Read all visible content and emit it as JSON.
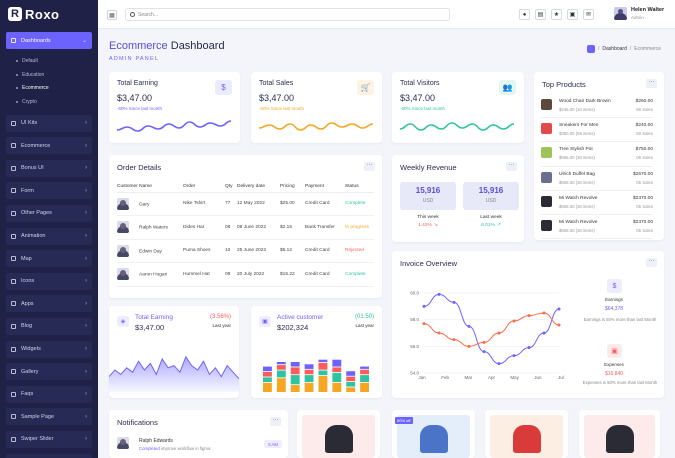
{
  "brand": {
    "logo_letter": "R",
    "name": "Roxo"
  },
  "sidebar": {
    "dashboards": "Dashboards",
    "sub_items": [
      "Default",
      "Education",
      "Ecommerce",
      "Crypto"
    ],
    "items": [
      "UI Kits",
      "Ecommerce",
      "Bonus UI",
      "Form",
      "Other Pages",
      "Animation",
      "Map",
      "Icons",
      "Apps",
      "Blog",
      "Widgets",
      "Gallery",
      "Faqs",
      "Sample Page",
      "Swiper Slider",
      "Tables"
    ]
  },
  "topbar": {
    "search_placeholder": "Search...",
    "user_name": "Helen Walter",
    "user_role": "Admin"
  },
  "page": {
    "title_accent": "Ecommerce",
    "title_rest": " Dashboard",
    "subtitle": "ADMIN PANEL",
    "breadcrumb": [
      "Dashboard",
      "Ecommerce"
    ]
  },
  "kpis": [
    {
      "label": "Total Earning",
      "value": "$3,47.00",
      "note": "-50% Since last month",
      "color": "#6c63ff",
      "icon": "dollar-icon",
      "symbol": "$",
      "trend": [
        0.3,
        0.45,
        0.25,
        0.5,
        0.35,
        0.6,
        0.4,
        0.7,
        0.45,
        0.65,
        0.5,
        0.75
      ]
    },
    {
      "label": "Total Sales",
      "value": "$3,47.00",
      "note": "-50% Since last month",
      "color": "#f5a623",
      "icon": "cart-icon",
      "symbol": "🛒",
      "trend": [
        0.4,
        0.55,
        0.35,
        0.6,
        0.3,
        0.55,
        0.35,
        0.65,
        0.45,
        0.6,
        0.4,
        0.6
      ]
    },
    {
      "label": "Total Visitors",
      "value": "$3,47.00",
      "note": "-50% Since last month",
      "color": "#2ec4a0",
      "icon": "users-icon",
      "symbol": "👥",
      "trend": [
        0.35,
        0.6,
        0.3,
        0.55,
        0.35,
        0.65,
        0.4,
        0.6,
        0.3,
        0.55,
        0.35,
        0.6
      ]
    }
  ],
  "orders": {
    "title": "Order Details",
    "columns": [
      "Customer Name",
      "Order",
      "Qty",
      "Delivery date",
      "Pricing",
      "Payment",
      "Status"
    ],
    "rows": [
      {
        "name": "Gary",
        "order": "Nike Tshirt",
        "qty": "77",
        "date": "12 May 2022",
        "price": "$25.00",
        "payment": "Credit Card",
        "status": "Complete",
        "status_color": "#2ec4a0"
      },
      {
        "name": "Ralph Waters",
        "order": "Dides Hat",
        "qty": "08",
        "date": "08 June 2022",
        "price": "$2.15",
        "payment": "Bank Transfer",
        "status": "In progress",
        "status_color": "#f5a623"
      },
      {
        "name": "Edwin Day",
        "order": "Puma Shoes",
        "qty": "10",
        "date": "25 June 2022",
        "price": "$5.12",
        "payment": "Credit Card",
        "status": "Rejected",
        "status_color": "#ff5b5b"
      },
      {
        "name": "Aaron Hogan",
        "order": "Hummel Hat",
        "qty": "08",
        "date": "20 July 2022",
        "price": "$15.22",
        "payment": "Credit Card",
        "status": "Complete",
        "status_color": "#2ec4a0"
      }
    ]
  },
  "weekly": {
    "title": "Weekly Revenue",
    "boxes": [
      {
        "value": "15,916",
        "currency": "USD",
        "label": "This week",
        "change": "1.42%",
        "change_color": "#ff5b5b",
        "arrow": "↘"
      },
      {
        "value": "15,916",
        "currency": "USD",
        "label": "Last week",
        "change": "8.01%",
        "change_color": "#2ec4a0",
        "arrow": "↗"
      }
    ]
  },
  "top_products": {
    "title": "Top Products",
    "items": [
      {
        "name": "Wood Chair Dark Brown",
        "price": "$246.00 (10 items)",
        "amount": "$260.00",
        "sales": "66 Sales",
        "color": "#5b4a3a"
      },
      {
        "name": "Sneakers For Men",
        "price": "$350.00 (59 items)",
        "amount": "$240.00",
        "sales": "58 Sales",
        "color": "#e24a4a"
      },
      {
        "name": "Tree Stylish Pot",
        "price": "$566.00 (30 items)",
        "amount": "$750.00",
        "sales": "06 Sales",
        "color": "#9cc45a"
      },
      {
        "name": "Ulrich Duffel Bag",
        "price": "$566.00 (30 items)",
        "amount": "$2570.00",
        "sales": "06 Sales",
        "color": "#6a6f8f"
      },
      {
        "name": "Mi Watch Revolve",
        "price": "$566.00 (30 items)",
        "amount": "$2370.00",
        "sales": "06 Sales",
        "color": "#2b2b35"
      },
      {
        "name": "Mi Watch Revolve",
        "price": "$566.00 (30 items)",
        "amount": "$2370.00",
        "sales": "06 Sales",
        "color": "#2b2b35"
      }
    ]
  },
  "earning_card": {
    "title": "Total Earning",
    "value": "$3,47.00",
    "change": "(3.56%)",
    "change_color": "#ff5b5b",
    "period": "Last year"
  },
  "active_card": {
    "title": "Active customer",
    "value": "$202,324",
    "change": "(01.50)",
    "change_color": "#2ec4a0",
    "period": "Last year"
  },
  "invoice": {
    "title": "Invoice Overview",
    "earnings": {
      "label": "Earnings",
      "value": "$64,378",
      "note": "Earnings is 50% more than last Month",
      "color": "#6c63ff"
    },
    "expenses": {
      "label": "Expenses",
      "value": "$16,840",
      "note": "Expenses is 50% more than last Month",
      "color": "#ff5b5b"
    }
  },
  "chart_data": [
    {
      "type": "line",
      "title": "",
      "x": [
        "Jan",
        "Feb",
        "Mar",
        "Apr",
        "May",
        "Jun",
        "Jul"
      ],
      "ylim": [
        54,
        60
      ],
      "yticks": [
        "60.0",
        "58.0",
        "56.0",
        "54.0"
      ],
      "series": [
        {
          "values": [
            59,
            59.9,
            59.3,
            57.5,
            55.6,
            54.7,
            55.3,
            55.9,
            57,
            58.8
          ],
          "color": "#6c63ff"
        },
        {
          "values": [
            57.7,
            57,
            56.5,
            56,
            56.3,
            57,
            57.9,
            58.3,
            58.5,
            57.6
          ],
          "color": "#ff6b4a"
        }
      ]
    },
    {
      "type": "area",
      "values": [
        0.35,
        0.5,
        0.4,
        0.55,
        0.45,
        0.7,
        0.5,
        0.65,
        0.4,
        0.75,
        0.55,
        0.6,
        0.45,
        0.8,
        0.6,
        0.5,
        0.7,
        0.4,
        0.55,
        0.35,
        0.6,
        0.45,
        0.3
      ]
    },
    {
      "type": "bar",
      "stacked": true,
      "categories": [
        "1",
        "2",
        "3",
        "4",
        "5",
        "6",
        "7",
        "8"
      ],
      "series": [
        {
          "color": "#f5a623",
          "values": [
            2,
            3,
            1.5,
            2,
            3.5,
            2,
            1,
            2
          ]
        },
        {
          "color": "#2ec4a0",
          "values": [
            1,
            1.5,
            2,
            1.5,
            1,
            2,
            1,
            1.5
          ]
        },
        {
          "color": "#ff5b5b",
          "values": [
            1,
            1,
            1.5,
            1,
            1.5,
            1,
            1,
            1
          ]
        },
        {
          "color": "#6c63ff",
          "values": [
            1,
            0.5,
            1,
            1,
            0.5,
            1.5,
            1,
            0.5
          ]
        }
      ]
    }
  ],
  "notifications": {
    "title": "Notifications",
    "name": "Ralph Edwards",
    "text_status": "Completed",
    "text_rest": " improve workflow in figma",
    "time": "5 AM"
  },
  "products_row": [
    {
      "badge": "",
      "color": "#fdeaea"
    },
    {
      "badge": "50% off",
      "color": "#e4eefb"
    },
    {
      "badge": "",
      "color": "#fdeee3"
    },
    {
      "badge": "",
      "color": "#fdeaea"
    }
  ]
}
